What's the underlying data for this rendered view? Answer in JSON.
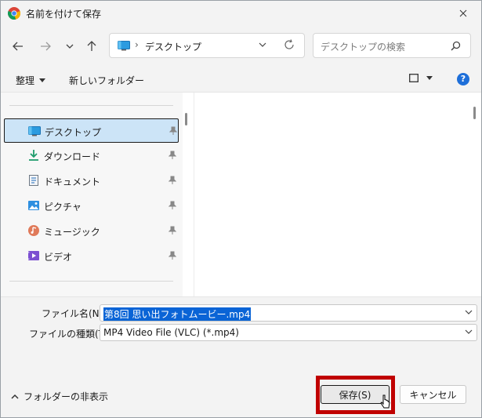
{
  "window": {
    "title": "名前を付けて保存",
    "app_icon": "chrome-icon"
  },
  "nav": {
    "back_icon": "arrow-left-icon",
    "forward_icon": "arrow-right-icon",
    "recent_icon": "chevron-down-icon",
    "up_icon": "arrow-up-icon"
  },
  "address": {
    "location": "デスクトップ",
    "separator": "›"
  },
  "search": {
    "placeholder": "デスクトップの検索"
  },
  "command_bar": {
    "organize_label": "整理",
    "new_folder_label": "新しいフォルダー"
  },
  "sidebar": {
    "items": [
      {
        "label": "デスクトップ",
        "icon": "desktop-icon",
        "selected": true
      },
      {
        "label": "ダウンロード",
        "icon": "download-icon",
        "selected": false
      },
      {
        "label": "ドキュメント",
        "icon": "document-icon",
        "selected": false
      },
      {
        "label": "ピクチャ",
        "icon": "pictures-icon",
        "selected": false
      },
      {
        "label": "ミュージック",
        "icon": "music-icon",
        "selected": false
      },
      {
        "label": "ビデオ",
        "icon": "video-icon",
        "selected": false
      }
    ]
  },
  "form": {
    "filename_label": "ファイル名(N):",
    "filename_value": "第8回 思い出フォトムービー.mp4",
    "filetype_label": "ファイルの種類(T):",
    "filetype_value": "MP4 Video File (VLC) (*.mp4)"
  },
  "footer": {
    "hide_folders_label": "フォルダーの非表示",
    "save_label": "保存(S)",
    "cancel_label": "キャンセル"
  },
  "colors": {
    "accent": "#0a64d6",
    "highlight_box": "#c00000",
    "selected_nav": "#cce4f7"
  }
}
